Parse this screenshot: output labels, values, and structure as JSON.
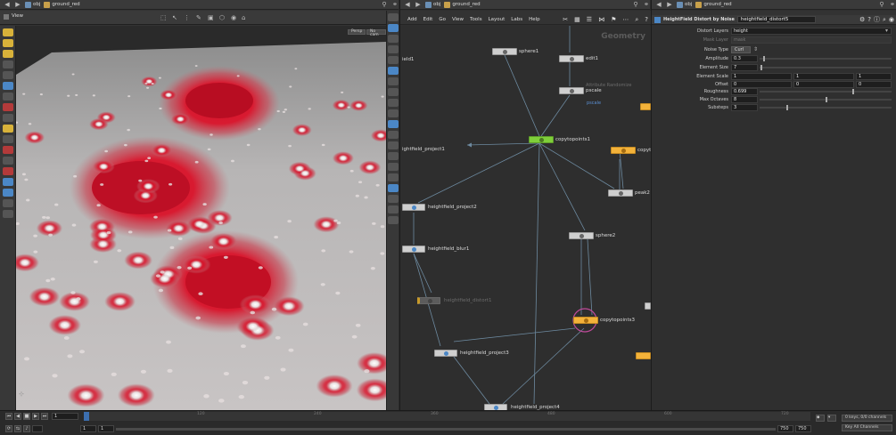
{
  "viewer": {
    "path": {
      "context": "obj",
      "node": "ground_red"
    },
    "tab_label": "View",
    "vp_buttons": [
      "Persp",
      "No cam"
    ]
  },
  "network": {
    "path": {
      "context": "obj",
      "node": "ground_red"
    },
    "menu": [
      "Add",
      "Edit",
      "Go",
      "View",
      "Tools",
      "Layout",
      "Labs",
      "Help"
    ],
    "context_title": "Geometry",
    "nodes": {
      "sphere1": "sphere1",
      "edit1": "edit1",
      "attr_randomize": "Attribute Randomize",
      "pscale": "pscale",
      "pscale_sub": "pscale",
      "heightfield_project1": "ightfield_project1",
      "copytopoints1": "copytopoints1",
      "copytopoints_right": "copytop",
      "peak": "peak2",
      "heightfield_project2": "heightfield_project2",
      "sphere2": "sphere2",
      "heightfield_blur1": "heightfield_blur1",
      "heightfield_distort1": "heightfield_distort1",
      "copytopoints3": "copytopoints3",
      "heightfield_project3": "heightfield_project3",
      "heightfield_project4": "heightfield_project4",
      "left_cut": "ield1"
    }
  },
  "params": {
    "path": {
      "context": "obj",
      "node": "ground_red"
    },
    "node_type": "HeightField Distort by Noise",
    "node_name": "heightfield_distort5",
    "distort_layers_label": "Distort Layers",
    "distort_layers": "height",
    "mask_layer_label": "Mask Layer",
    "mask_layer": "mask",
    "noise_type_label": "Noise Type",
    "noise_type": "Curl",
    "amplitude_label": "Amplitude",
    "amplitude": "0.3",
    "element_size_label": "Element Size",
    "element_size": "7",
    "element_scale_label": "Element Scale",
    "element_scale": [
      "1",
      "1",
      "1"
    ],
    "offset_label": "Offset",
    "offset": [
      "0",
      "0",
      "0"
    ],
    "roughness_label": "Roughness",
    "roughness": "0.699",
    "max_octaves_label": "Max Octaves",
    "max_octaves": "8",
    "substeps_label": "Substeps",
    "substeps": "3",
    "levels": {
      "amplitude": 0.03,
      "element_size": 0.005,
      "roughness": 0.7,
      "max_octaves": 0.5,
      "substeps": 0.2
    }
  },
  "timeline": {
    "current_frame": "1",
    "start": "1",
    "start2": "1",
    "end": "750",
    "end2": "750",
    "ticks": [
      "120",
      "240",
      "360",
      "480",
      "600",
      "720"
    ],
    "keys_label": "0 keys, 0/0 channels",
    "key_all_label": "Key All Channels"
  }
}
